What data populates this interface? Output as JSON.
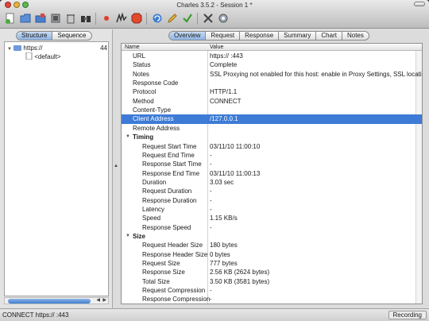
{
  "window": {
    "title": "Charles 3.5.2 - Session 1 *"
  },
  "toolbar": {
    "buttons": [
      {
        "icon": "new-session-icon"
      },
      {
        "icon": "open-icon"
      },
      {
        "icon": "save-icon"
      },
      {
        "icon": "clear-icon"
      },
      {
        "icon": "trash-icon"
      },
      {
        "icon": "find-icon"
      },
      {
        "icon": "record-icon"
      },
      {
        "icon": "throttle-icon"
      },
      {
        "icon": "breakpoints-icon"
      },
      {
        "icon": "refresh-icon"
      },
      {
        "icon": "edit-icon"
      },
      {
        "icon": "validate-icon"
      },
      {
        "icon": "tools-icon"
      },
      {
        "icon": "settings-icon"
      }
    ]
  },
  "left": {
    "tabs": [
      "Structure",
      "Sequence"
    ],
    "active_tab": "Structure",
    "tree": [
      {
        "label": "https://",
        "right": "44",
        "level": 0
      },
      {
        "label": "<default>",
        "right": "",
        "level": 1
      }
    ]
  },
  "right": {
    "tabs": [
      "Overview",
      "Request",
      "Response",
      "Summary",
      "Chart",
      "Notes"
    ],
    "active_tab": "Overview",
    "columns": [
      "Name",
      "Value"
    ],
    "rows": [
      {
        "k": "URL",
        "v": "https://                        :443",
        "type": "item"
      },
      {
        "k": "Status",
        "v": "Complete",
        "type": "item"
      },
      {
        "k": "Notes",
        "v": "SSL Proxying not enabled for this host: enable in Proxy Settings, SSL locations",
        "type": "item"
      },
      {
        "k": "Response Code",
        "v": "",
        "type": "item"
      },
      {
        "k": "Protocol",
        "v": "HTTP/1.1",
        "type": "item"
      },
      {
        "k": "Method",
        "v": "CONNECT",
        "type": "item"
      },
      {
        "k": "Content-Type",
        "v": "",
        "type": "item"
      },
      {
        "k": "Client Address",
        "v": "/127.0.0.1",
        "type": "item",
        "selected": true
      },
      {
        "k": "Remote Address",
        "v": "",
        "type": "item"
      },
      {
        "k": "Timing",
        "v": "",
        "type": "section"
      },
      {
        "k": "Request Start Time",
        "v": "03/11/10 11:00:10",
        "type": "sub"
      },
      {
        "k": "Request End Time",
        "v": "-",
        "type": "sub"
      },
      {
        "k": "Response Start Time",
        "v": "-",
        "type": "sub"
      },
      {
        "k": "Response End Time",
        "v": "03/11/10 11:00:13",
        "type": "sub"
      },
      {
        "k": "Duration",
        "v": "3.03 sec",
        "type": "sub"
      },
      {
        "k": "Request Duration",
        "v": "-",
        "type": "sub"
      },
      {
        "k": "Response Duration",
        "v": "-",
        "type": "sub"
      },
      {
        "k": "Latency",
        "v": "-",
        "type": "sub"
      },
      {
        "k": "Speed",
        "v": "1.15 KB/s",
        "type": "sub"
      },
      {
        "k": "Response Speed",
        "v": "-",
        "type": "sub"
      },
      {
        "k": "Size",
        "v": "",
        "type": "section"
      },
      {
        "k": "Request Header Size",
        "v": "180 bytes",
        "type": "sub"
      },
      {
        "k": "Response Header Size",
        "v": "0 bytes",
        "type": "sub"
      },
      {
        "k": "Request Size",
        "v": "777 bytes",
        "type": "sub"
      },
      {
        "k": "Response Size",
        "v": "2.56 KB (2624 bytes)",
        "type": "sub"
      },
      {
        "k": "Total Size",
        "v": "3.50 KB (3581 bytes)",
        "type": "sub"
      },
      {
        "k": "Request Compression",
        "v": "-",
        "type": "sub"
      },
      {
        "k": "Response Compression",
        "v": "-",
        "type": "sub"
      }
    ]
  },
  "status": {
    "text": "CONNECT https://                        :443",
    "right": "Recording"
  }
}
